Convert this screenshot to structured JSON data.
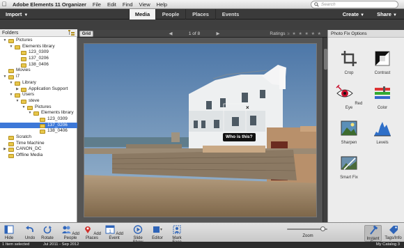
{
  "menubar": {
    "app_name": "Adobe Elements 11 Organizer",
    "menus": [
      "File",
      "Edit",
      "Find",
      "View",
      "Help"
    ],
    "search_placeholder": "Search"
  },
  "nav": {
    "import_label": "Import",
    "tabs": [
      "Media",
      "People",
      "Places",
      "Events"
    ],
    "active_tab": "Media",
    "create_label": "Create",
    "share_label": "Share"
  },
  "folders": {
    "title": "Folders",
    "items": [
      {
        "label": "Pictures",
        "depth": 0,
        "expanded": true
      },
      {
        "label": "Elements library",
        "depth": 1,
        "expanded": true
      },
      {
        "label": "123_0309",
        "depth": 2
      },
      {
        "label": "137_0206",
        "depth": 2
      },
      {
        "label": "138_0406",
        "depth": 2
      },
      {
        "label": "Movies",
        "depth": 0
      },
      {
        "label": "i7",
        "depth": 0,
        "expanded": true
      },
      {
        "label": "Library",
        "depth": 1,
        "expanded": true
      },
      {
        "label": "Application Support",
        "depth": 2,
        "collapsed": true
      },
      {
        "label": "Users",
        "depth": 1,
        "expanded": true
      },
      {
        "label": "steve",
        "depth": 2,
        "expanded": true
      },
      {
        "label": "Pictures",
        "depth": 3,
        "expanded": true
      },
      {
        "label": "Elements library",
        "depth": 4,
        "expanded": true
      },
      {
        "label": "123_0309",
        "depth": 5
      },
      {
        "label": "137_0206",
        "depth": 5,
        "selected": true
      },
      {
        "label": "138_0406",
        "depth": 5
      },
      {
        "label": "Scratch",
        "depth": 0
      },
      {
        "label": "Time Machine",
        "depth": 0
      },
      {
        "label": "CANON_DC",
        "depth": 0,
        "collapsed": true
      },
      {
        "label": "Offline Media",
        "depth": 0
      }
    ]
  },
  "viewer": {
    "grid_label": "Grid",
    "counter": "1 of 8",
    "ratings_label": "Ratings",
    "ratings_stars": "≥ ★ ★ ★ ★ ★",
    "face_tag_label": "Who is this?"
  },
  "fix_panel": {
    "title": "Photo Fix Options",
    "items": [
      "Crop",
      "Contrast",
      "Red Eye",
      "Color",
      "Sharpen",
      "Levels",
      "Smart Fix"
    ]
  },
  "toolbar": {
    "items": [
      "Hide",
      "Undo",
      "Rotate",
      "Add People",
      "Add Places",
      "Add Event",
      "Slide Show",
      "Editor",
      "Mark Face"
    ],
    "zoom_label": "Zoom",
    "zoom_level": 0.88,
    "right_items": [
      "Instant Fix",
      "Tags/Info"
    ]
  },
  "status": {
    "selection": "1 Item selected",
    "date_range": "Jul 2011 - Sep 2012",
    "catalog": "My Catalog 3"
  },
  "colors": {
    "selection_blue": "#3d78d8",
    "nav_dark": "#3a3a3a"
  }
}
